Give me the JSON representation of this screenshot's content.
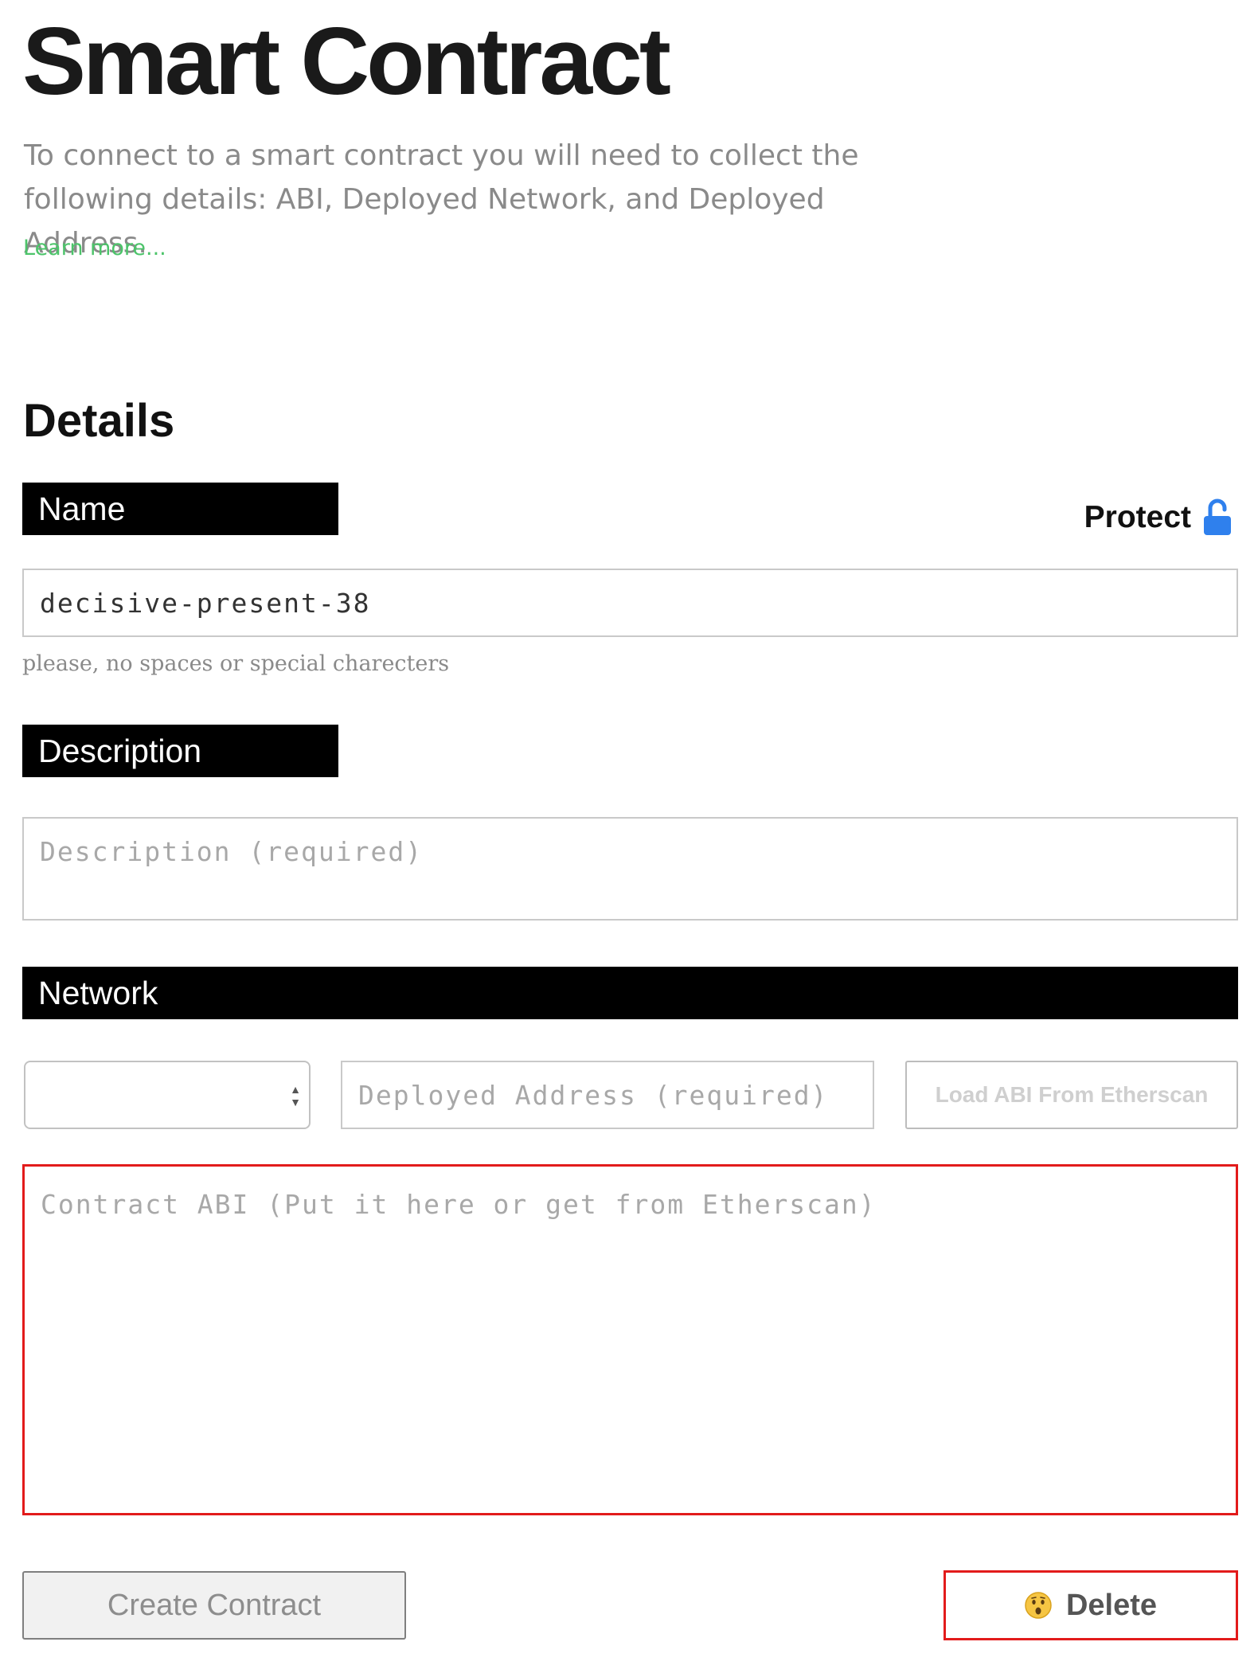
{
  "header": {
    "title": "Smart Contract",
    "intro": "To connect to a smart contract you will need to collect the following details: ABI, Deployed Network, and Deployed Address.",
    "learn_more": "Learn more..."
  },
  "details": {
    "heading": "Details",
    "protect_label": "Protect",
    "protect_icon": "unlocked-padlock-icon",
    "protect_color": "#2f80ed",
    "name": {
      "label": "Name",
      "value": "decisive-present-38",
      "hint": "please, no spaces or special charecters"
    },
    "description": {
      "label": "Description",
      "placeholder": "Description (required)"
    },
    "network": {
      "label": "Network",
      "selected": "",
      "address_placeholder": "Deployed Address (required)",
      "etherscan_button": "Load ABI From Etherscan"
    },
    "abi": {
      "placeholder": "Contract ABI (Put it here or get from Etherscan)"
    }
  },
  "actions": {
    "create_label": "Create Contract",
    "delete_label": "Delete",
    "delete_icon": "surprised-face-emoji-icon"
  },
  "colors": {
    "link_green": "#4cc46a",
    "error_red": "#e21b1b",
    "label_bar": "#000000"
  }
}
